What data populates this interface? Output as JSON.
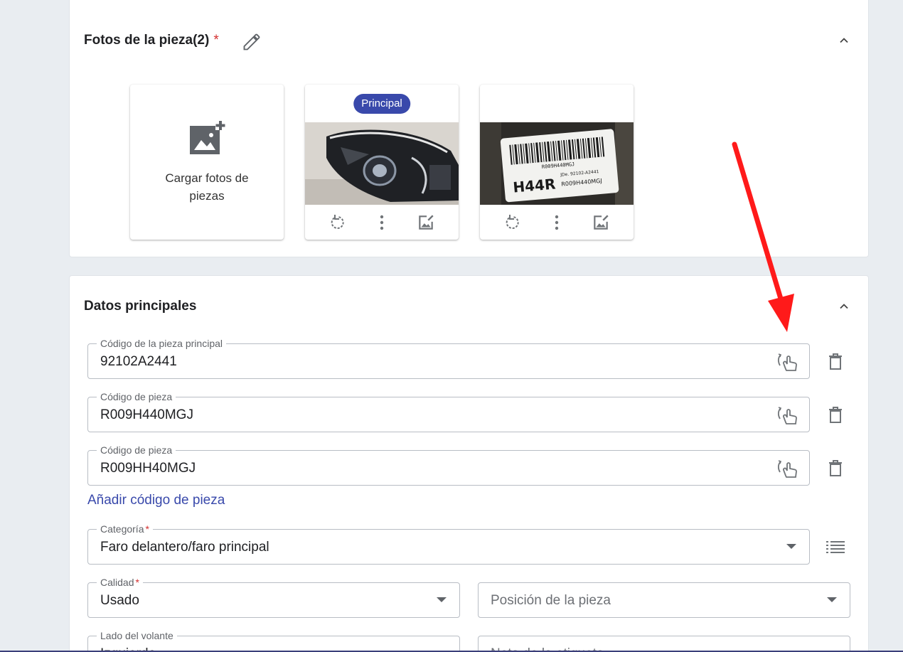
{
  "photos_section": {
    "title": "Fotos de la pieza(2)",
    "required_mark": "*",
    "upload_label": "Cargar fotos de piezas",
    "principal_badge": "Principal",
    "photos": [
      {
        "name": "headlight-photo",
        "is_principal": true
      },
      {
        "name": "label-photo",
        "is_principal": false,
        "label_lines": [
          "R009H440MGJ",
          "H44R",
          "JDe. 92102-A2441",
          "R009H440MGJ"
        ]
      }
    ]
  },
  "main_section": {
    "title": "Datos principales",
    "part_codes": [
      {
        "label": "Código de la pieza principal",
        "value": "92102A2441"
      },
      {
        "label": "Código de pieza",
        "value": "R009H440MGJ"
      },
      {
        "label": "Código de pieza",
        "value": "R009HH40MGJ"
      }
    ],
    "add_code_link": "Añadir código de pieza",
    "category": {
      "label": "Categoría",
      "required_mark": "*",
      "value": "Faro delantero/faro principal"
    },
    "quality": {
      "label": "Calidad",
      "required_mark": "*",
      "value": "Usado"
    },
    "position": {
      "placeholder": "Posición de la pieza"
    },
    "steering_side": {
      "label": "Lado del volante",
      "value": "Izquierdo"
    },
    "label_note": {
      "placeholder": "Nota de la etiqueta"
    }
  },
  "colors": {
    "accent": "#3949ab",
    "required": "#d32f2f",
    "annotation_arrow": "#ff1a1a"
  }
}
